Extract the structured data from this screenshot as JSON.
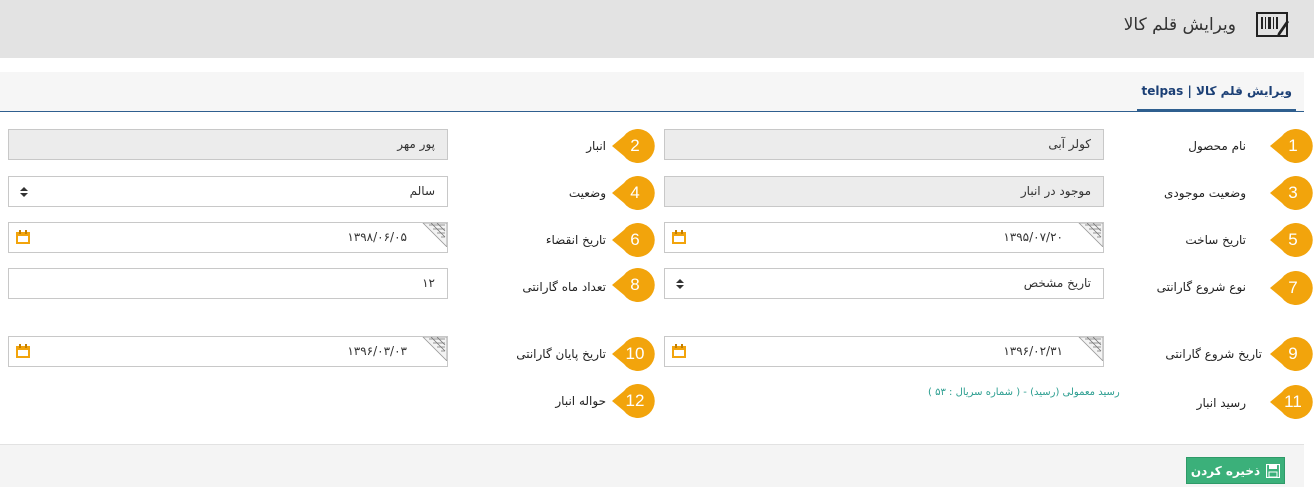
{
  "header": {
    "title": "ویرایش قلم کالا",
    "icon": "barcode-icon"
  },
  "tab": {
    "label": "ویرایش قلم کالا | telpas"
  },
  "colors": {
    "accent": "#2f5f8f",
    "marker": "#f2a40c",
    "save": "#3bb07a",
    "link": "#2a9d8f"
  },
  "fields": {
    "f1": {
      "marker": "1",
      "label": "نام محصول",
      "value": "کولر آبی"
    },
    "f2": {
      "marker": "2",
      "label": "انبار",
      "value": "پور مهر"
    },
    "f3": {
      "marker": "3",
      "label": "وضعیت موجودی",
      "value": "موجود در انبار"
    },
    "f4": {
      "marker": "4",
      "label": "وضعیت",
      "value": "سالم"
    },
    "f5": {
      "marker": "5",
      "label": "تاریخ ساخت",
      "value": "۱۳۹۵/۰۷/۲۰"
    },
    "f6": {
      "marker": "6",
      "label": "تاریخ انقضاء",
      "value": "۱۳۹۸/۰۶/۰۵"
    },
    "f7": {
      "marker": "7",
      "label": "نوع شروع گارانتی",
      "value": "تاریخ مشخص"
    },
    "f8": {
      "marker": "8",
      "label": "تعداد ماه گارانتی",
      "value": "۱۲"
    },
    "f9": {
      "marker": "9",
      "label": "تاریخ شروع گارانتی",
      "value": "۱۳۹۶/۰۲/۳۱"
    },
    "f10": {
      "marker": "10",
      "label": "تاریخ پایان گارانتی",
      "value": "۱۳۹۶/۰۳/۰۳"
    },
    "f11": {
      "marker": "11",
      "label": "رسید انبار",
      "link": "رسید معمولی (رسید) - ( شماره سریال : ۵۳ )"
    },
    "f12": {
      "marker": "12",
      "label": "حواله انبار"
    }
  },
  "footer": {
    "save_label": "ذخیره کردن"
  }
}
